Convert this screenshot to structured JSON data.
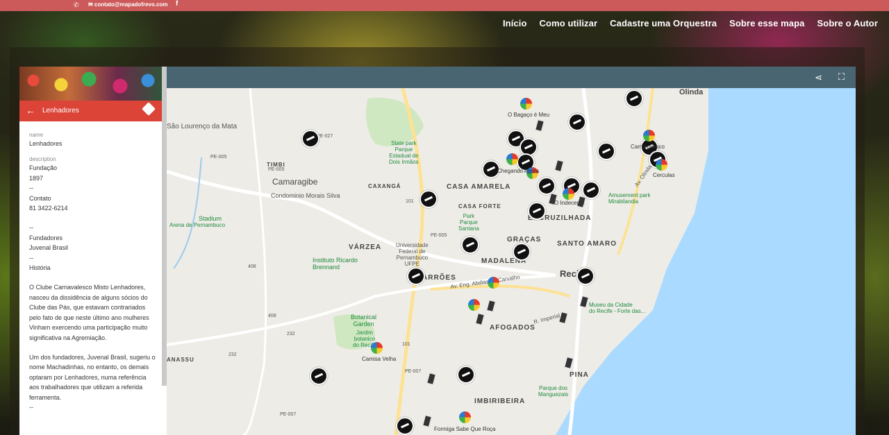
{
  "topbar": {
    "phone_icon": "phone-icon",
    "email": "✉ contato@mapadofrevo.com",
    "facebook": "f"
  },
  "nav": [
    "Início",
    "Como utilizar",
    "Cadastre uma Orquestra",
    "Sobre esse mapa",
    "Sobre o Autor"
  ],
  "panel": {
    "title": "Lenhadores",
    "name_label": "name",
    "name_value": "Lenhadores",
    "desc_label": "description",
    "lines": [
      "Fundação",
      "1897",
      "--",
      "Contato",
      "81 3422-6214",
      "",
      "--",
      "Fundadores",
      "Juvenal Brasil",
      "--",
      "História"
    ],
    "para1": "O Clube Carnavalesco Misto Lenhadores, nasceu da dissidência de alguns sócios do Clube das Pás, que estavam contrariados pelo fato de que neste último ano mulheres Vinham exercendo uma participação muito significativa na Agremiação.",
    "para2": "Um dos fundadores, Juvenal Brasil, sugeriu o nome Machadinhas, no entanto, os demais optaram por Lenhadores, numa referência aos trabalhadores que utilizam a referida ferramenta.",
    "tail": "--"
  },
  "map": {
    "places": [
      "São Lourenço\nda Mata",
      "Camaragibe",
      "Condominio Morais Silva",
      "Stadium",
      "Arena de Pernambuco",
      "State park\nParque\nEstadual de\nDois Irmãos",
      "Universidade\nFederal de\nPernambuco\nUFPE",
      "Instituto Ricardo\nBrennand",
      "Botanical\nGarden",
      "Jardim\nbotanico\ndo Recife",
      "Park\nParque\nSantana",
      "Amusement park\nMirabilandia",
      "Museu da Cidade\ndo Recife - Forte das...",
      "Parque dos\nManguezais",
      "Olinda",
      "Reci"
    ],
    "neighborhoods": [
      "TIMBI",
      "CAXANGÁ",
      "CASA AMARELA",
      "CASA FORTE",
      "ENCRUZILHADA",
      "GRAÇAS",
      "SANTO AMARO",
      "VÁRZEA",
      "MADALENA",
      "ARRÕES",
      "AFOGADOS",
      "ANASSU",
      "PINA",
      "IMBIRIBEIRA"
    ],
    "markers": [
      "O Bagaço é Meu",
      "Chegando Agora",
      "O Indecente",
      "Carnavalesco",
      "Cerculas",
      "Camisa Velha",
      "Formiga Sabe Que Roça"
    ],
    "roads": [
      "PE-027",
      "PE-005",
      "PE-005",
      "101",
      "PE-005",
      "408",
      "408",
      "232",
      "232",
      "101",
      "PE-007",
      "PE-007",
      "Av. Eng. Abdias de Carvalho",
      "R. Imperial",
      "Av. Olinda"
    ],
    "share": "share-icon",
    "fullscreen": "fullscreen-icon"
  }
}
